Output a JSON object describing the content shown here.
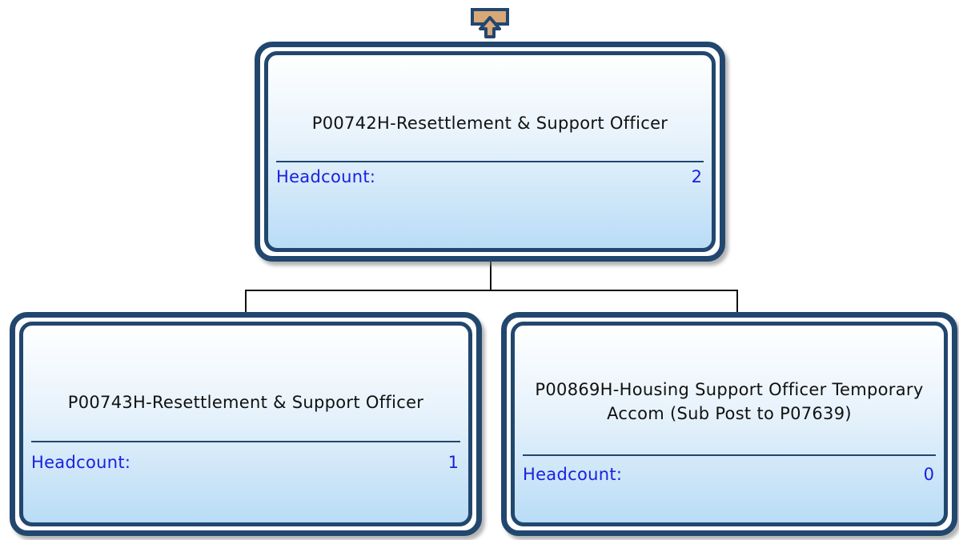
{
  "nodes": {
    "root": {
      "title": "P00742H-Resettlement & Support Officer",
      "count_label": "Headcount:",
      "count_value": "2"
    },
    "left": {
      "title": "P00743H-Resettlement & Support Officer",
      "count_label": "Headcount:",
      "count_value": "1"
    },
    "right": {
      "title": "P00869H-Housing Support Officer Temporary Accom (Sub Post to P07639)",
      "count_label": "Headcount:",
      "count_value": "0"
    }
  },
  "colors": {
    "border": "#22476e",
    "count_text": "#1a20e0",
    "up_icon_fill": "#d9a878"
  },
  "icons": {
    "up": "go-up-arrow-icon"
  }
}
